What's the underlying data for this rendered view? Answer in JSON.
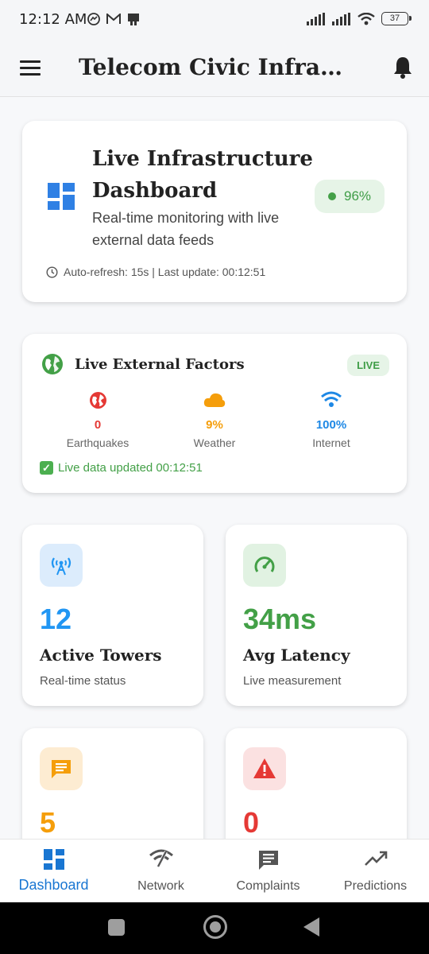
{
  "status_bar": {
    "time": "12:12 AM",
    "battery": "37"
  },
  "app_bar": {
    "title": "Telecom Civic Infrastr..."
  },
  "hero": {
    "title": "Live Infrastructure Dashboard",
    "subtitle": "Real-time monitoring with live external data feeds",
    "health": "96%",
    "meta": "Auto-refresh: 15s | Last update: 00:12:51"
  },
  "external": {
    "title": "Live External Factors",
    "badge": "LIVE",
    "factors": [
      {
        "value": "0",
        "label": "Earthquakes",
        "color": "#e53935",
        "icon": "globe-icon"
      },
      {
        "value": "9%",
        "label": "Weather",
        "color": "#f59e0b",
        "icon": "cloud-icon"
      },
      {
        "value": "100%",
        "label": "Internet",
        "color": "#1e88e5",
        "icon": "wifi-icon"
      }
    ],
    "updated": "Live data updated 00:12:51"
  },
  "stats": [
    {
      "value": "12",
      "label": "Active Towers",
      "sub": "Real-time status",
      "color": "#2196f3",
      "icon": "tower-icon"
    },
    {
      "value": "34ms",
      "label": "Avg Latency",
      "sub": "Live measurement",
      "color": "#43a047",
      "icon": "speedometer-icon"
    },
    {
      "value": "5",
      "label": "",
      "sub": "",
      "color": "#f59e0b",
      "icon": "message-icon"
    },
    {
      "value": "0",
      "label": "",
      "sub": "",
      "color": "#e53935",
      "icon": "warning-icon"
    }
  ],
  "nav": [
    {
      "label": "Dashboard",
      "icon": "dashboard-icon"
    },
    {
      "label": "Network",
      "icon": "network-icon"
    },
    {
      "label": "Complaints",
      "icon": "complaints-icon"
    },
    {
      "label": "Predictions",
      "icon": "trending-icon"
    }
  ]
}
